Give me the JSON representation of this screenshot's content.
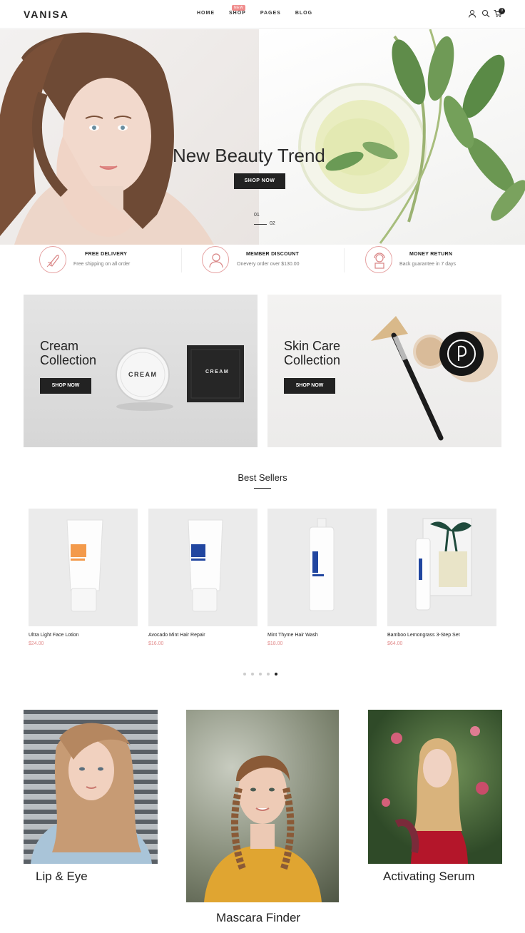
{
  "brand": {
    "logo": "VANISA"
  },
  "nav": {
    "items": [
      "HOME",
      "SHOP",
      "PAGES",
      "BLOG"
    ],
    "shop_badge": "NEW"
  },
  "header": {
    "cart_count": "0",
    "icons": [
      "user-icon",
      "search-icon",
      "cart-icon"
    ]
  },
  "hero": {
    "title": "New Beauty Trend",
    "button": "SHOP NOW",
    "slide_current": "01",
    "slide_next": "02"
  },
  "features": [
    {
      "icon": "rocket-icon",
      "title": "FREE DELIVERY",
      "subtitle": "Free shipping on all order"
    },
    {
      "icon": "person-icon",
      "title": "MEMBER DISCOUNT",
      "subtitle": "Onevery order over $130.00"
    },
    {
      "icon": "support-agent-icon",
      "title": "MONEY RETURN",
      "subtitle": "Back guarantee in 7 days"
    }
  ],
  "collections": [
    {
      "title_line1": "Cream",
      "title_line2": "Collection",
      "button": "SHOP NOW",
      "jar_label": "CREAM",
      "box_label": "CREAM"
    },
    {
      "title_line1": "Skin Care",
      "title_line2": "Collection",
      "button": "SHOP NOW"
    }
  ],
  "best_sellers": {
    "title": "Best Sellers",
    "products": [
      {
        "name": "Ultra Light Face Lotion",
        "price": "$24.00"
      },
      {
        "name": "Avocado Mint Hair Repair",
        "price": "$16.00"
      },
      {
        "name": "Mint Thyme Hair Wash",
        "price": "$18.00"
      },
      {
        "name": "Bamboo Lemongrass 3-Step Set",
        "price": "$64.00"
      }
    ],
    "pagination_active": 5,
    "pagination_total": 5
  },
  "categories": [
    {
      "label": "Lip & Eye"
    },
    {
      "label": "Mascara Finder"
    },
    {
      "label": "Activating Serum"
    }
  ],
  "colors": {
    "accent": "#e28a8a",
    "dark": "#222222",
    "badge": "#f08c8c"
  }
}
